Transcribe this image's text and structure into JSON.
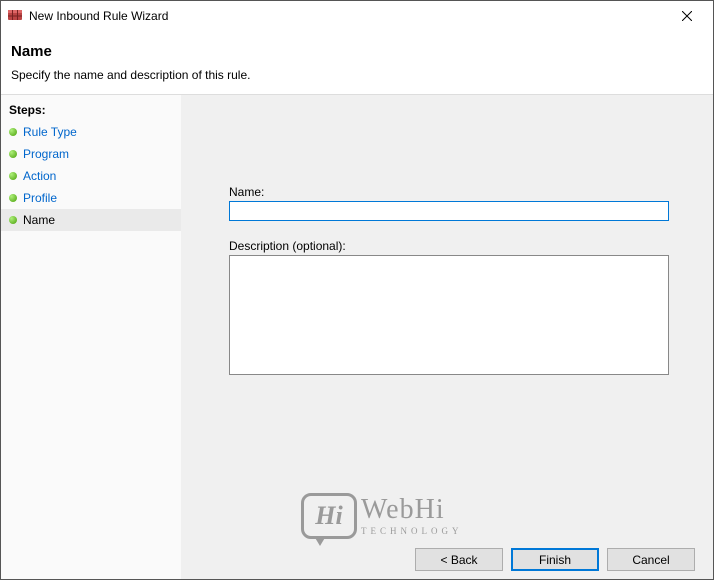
{
  "window": {
    "title": "New Inbound Rule Wizard"
  },
  "header": {
    "heading": "Name",
    "subtitle": "Specify the name and description of this rule."
  },
  "sidebar": {
    "label": "Steps:",
    "items": [
      {
        "label": "Rule Type",
        "link": true,
        "current": false
      },
      {
        "label": "Program",
        "link": true,
        "current": false
      },
      {
        "label": "Action",
        "link": true,
        "current": false
      },
      {
        "label": "Profile",
        "link": true,
        "current": false
      },
      {
        "label": "Name",
        "link": false,
        "current": true
      }
    ]
  },
  "form": {
    "name_label": "Name:",
    "name_value": "",
    "description_label": "Description (optional):",
    "description_value": ""
  },
  "buttons": {
    "back": "< Back",
    "finish": "Finish",
    "cancel": "Cancel"
  },
  "watermark": {
    "bubble": "Hi",
    "brand_top": "WebHi",
    "brand_bottom": "TECHNOLOGY"
  }
}
